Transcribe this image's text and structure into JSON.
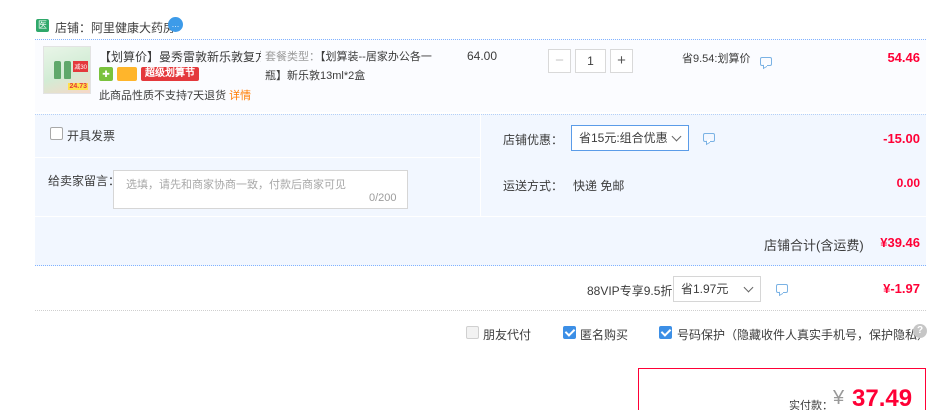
{
  "shop": {
    "icon_text": "医",
    "name": "店铺：阿里健康大药房",
    "wangwang_text": "…"
  },
  "item": {
    "thumb": {
      "tag": "减30",
      "price": "24.73"
    },
    "title": "【划算价】曼秀雷敦新乐敦复方...",
    "badge_label": "超级划算节",
    "notice": "此商品性质不支持7天退货",
    "detail_link": "详情",
    "sku_label": "套餐类型：",
    "sku_value": "【划算装--居家办公各一瓶】新乐敦13ml*2盒",
    "unit_price": "64.00",
    "qty_minus": "−",
    "quantity": "1",
    "qty_plus": "+",
    "saving": "省9.54:划算价",
    "total": "54.46"
  },
  "panel": {
    "invoice_label": "开具发票",
    "message_label": "给卖家留言：",
    "message_placeholder": "选填，请先和商家协商一致，付款后商家可见",
    "message_count": "0/200",
    "coupon_label": "店铺优惠：",
    "coupon_selected": "省15元:组合优惠",
    "coupon_value": "-15.00",
    "shipping_label": "运送方式：",
    "shipping_method": "快递 免邮",
    "shipping_value": "0.00",
    "shop_total_label": "店铺合计(含运费)",
    "shop_total_value": "¥39.46"
  },
  "vip": {
    "label": "88VIP专享9.5折",
    "selected": "省1.97元",
    "value": "¥-1.97"
  },
  "options": {
    "friend_pay": "朋友代付",
    "anonymous": "匿名购买",
    "number_protect": "号码保护（隐藏收件人真实手机号，保护隐私）",
    "help": "?"
  },
  "payment": {
    "label": "实付款：",
    "currency": "¥",
    "amount": "37.49"
  },
  "colors": {
    "price_red": "#ff0036",
    "link_orange": "#ff7c00",
    "accent_blue": "#3c8fe6",
    "panel_bg": "#f2f7ff"
  }
}
